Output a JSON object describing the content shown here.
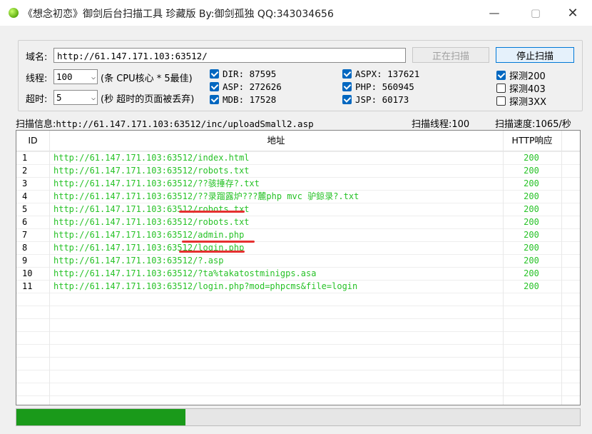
{
  "window": {
    "title": "《想念初恋》御剑后台扫描工具 珍藏版 By:御剑孤独 QQ:343034656",
    "icons": {
      "minimize": "minimize-icon",
      "maximize": "maximize-icon",
      "close": "close-icon"
    }
  },
  "form": {
    "domain_label": "域名:",
    "domain_value": "http://61.147.171.103:63512/",
    "scanning_button": "正在扫描",
    "stop_button": "停止扫描",
    "threads_label": "线程:",
    "threads_value": "100",
    "threads_hint": "(条 CPU核心 * 5最佳)",
    "timeout_label": "超时:",
    "timeout_value": "5",
    "timeout_hint": "(秒 超时的页面被丢弃)"
  },
  "dictionaries": [
    {
      "label": "DIR: 87595",
      "checked": true
    },
    {
      "label": "ASP: 272626",
      "checked": true
    },
    {
      "label": "MDB: 17528",
      "checked": true
    },
    {
      "label": "ASPX: 137621",
      "checked": true
    },
    {
      "label": "PHP: 560945",
      "checked": true
    },
    {
      "label": "JSP: 60173",
      "checked": true
    }
  ],
  "probes": [
    {
      "label": "探测200",
      "checked": true
    },
    {
      "label": "探测403",
      "checked": false
    },
    {
      "label": "探测3XX",
      "checked": false
    }
  ],
  "status": {
    "info_label": "扫描信息:",
    "info_value": "http://61.147.171.103:63512/inc/uploadSmall2.asp",
    "threads_text": "扫描线程:100",
    "speed_text": "扫描速度:1065/秒"
  },
  "table": {
    "headers": {
      "id": "ID",
      "url": "地址",
      "code": "HTTP响应"
    },
    "rows": [
      {
        "id": "1",
        "url": "http://61.147.171.103:63512/index.html",
        "code": "200"
      },
      {
        "id": "2",
        "url": "http://61.147.171.103:63512/robots.txt",
        "code": "200"
      },
      {
        "id": "3",
        "url": "http://61.147.171.103:63512/??骇捶存?.txt",
        "code": "200"
      },
      {
        "id": "4",
        "url": "http://61.147.171.103:63512/??录蹓露炉???麓php mvc 驴鍄录?.txt",
        "code": "200"
      },
      {
        "id": "5",
        "url": "http://61.147.171.103:63512/robots.txt",
        "code": "200"
      },
      {
        "id": "6",
        "url": "http://61.147.171.103:63512/robots.txt",
        "code": "200"
      },
      {
        "id": "7",
        "url": "http://61.147.171.103:63512/admin.php",
        "code": "200"
      },
      {
        "id": "8",
        "url": "http://61.147.171.103:63512/login.php",
        "code": "200"
      },
      {
        "id": "9",
        "url": "http://61.147.171.103:63512/?.asp",
        "code": "200"
      },
      {
        "id": "10",
        "url": "http://61.147.171.103:63512/?ta%takatostminigps.asa",
        "code": "200"
      },
      {
        "id": "11",
        "url": "http://61.147.171.103:63512/login.php?mod=phpcms&file=login",
        "code": "200"
      }
    ]
  },
  "progress": {
    "fraction": 0.3
  },
  "colors": {
    "url_text": "#27c227",
    "progress": "#1a9a1a",
    "annotation": "#e53030"
  }
}
